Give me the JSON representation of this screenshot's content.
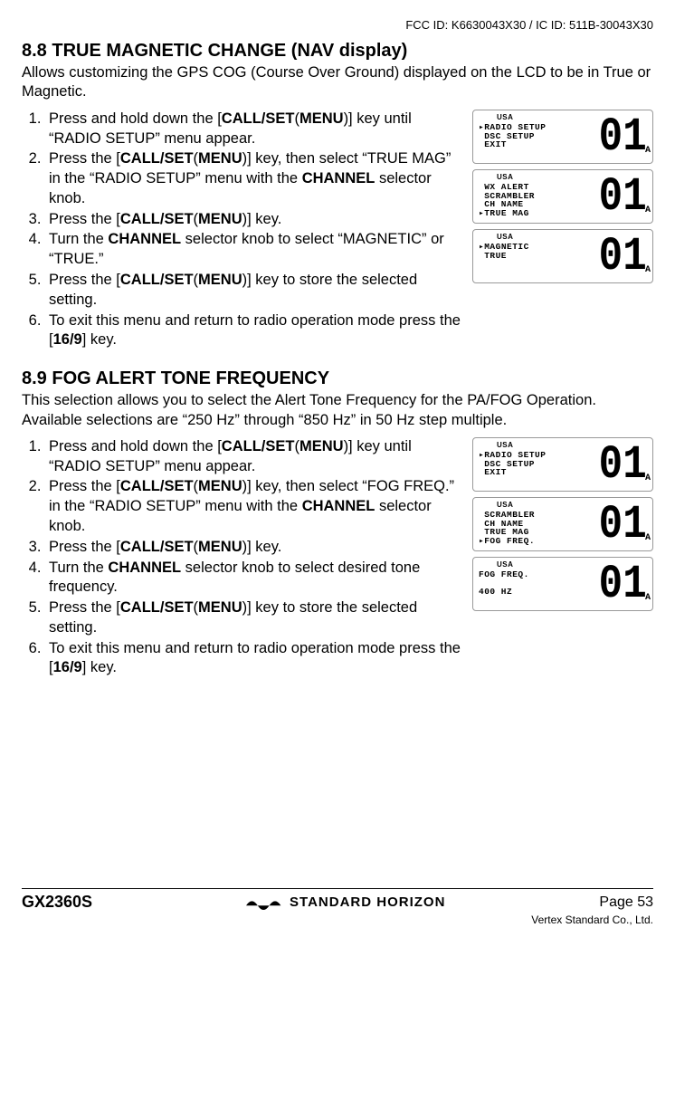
{
  "header": {
    "fcc": "FCC ID: K6630043X30 / IC ID: 511B-30043X30"
  },
  "sec88": {
    "title": "8.8  TRUE MAGNETIC CHANGE (NAV display)",
    "intro": "Allows customizing the GPS COG (Course Over Ground) displayed on the LCD to be in True or Magnetic.",
    "steps": [
      "Press and hold down the [CALL/SET(MENU)] key until “RADIO SETUP” menu appear.",
      "Press the [CALL/SET(MENU)] key, then select “TRUE MAG” in the “RADIO SETUP” menu with the CHANNEL selector knob.",
      "Press the [CALL/SET(MENU)] key.",
      "Turn the CHANNEL selector knob to select “MAGNETIC” or “TRUE.”",
      "Press the [CALL/SET(MENU)] key to store the selected setting.",
      "To exit this menu and return to radio operation mode press the [16/9] key."
    ],
    "lcd": [
      {
        "usa": "USA",
        "lines": "▸RADIO SETUP\n DSC SETUP\n EXIT",
        "ch": "01",
        "a": "A",
        "underline_line": 0
      },
      {
        "usa": "USA",
        "lines": " WX ALERT\n SCRAMBLER\n CH NAME\n▸TRUE MAG",
        "ch": "01",
        "a": "A"
      },
      {
        "usa": "USA",
        "lines": "▸MAGNETIC\n TRUE",
        "ch": "01",
        "a": "A"
      }
    ]
  },
  "sec89": {
    "title": "8.9  FOG ALERT TONE FREQUENCY",
    "intro": "This selection allows you to select the Alert Tone Frequency for the PA/FOG Operation. Available selections are “250 Hz” through “850 Hz” in 50 Hz step multiple.",
    "steps": [
      "Press and hold down the [CALL/SET(MENU)] key until “RADIO SETUP” menu appear.",
      "Press the [CALL/SET(MENU)] key, then select “FOG FREQ.” in the “RADIO SETUP” menu with the CHANNEL selector knob.",
      "Press the [CALL/SET(MENU)] key.",
      "Turn the CHANNEL selector knob to select desired tone frequency.",
      "Press the [CALL/SET(MENU)] key to store the selected setting.",
      "To exit this menu and return to radio operation mode press the [16/9] key."
    ],
    "lcd": [
      {
        "usa": "USA",
        "lines": "▸RADIO SETUP\n DSC SETUP\n EXIT",
        "ch": "01",
        "a": "A",
        "underline_line": 0
      },
      {
        "usa": "USA",
        "lines": " SCRAMBLER\n CH NAME\n TRUE MAG\n▸FOG FREQ.",
        "ch": "01",
        "a": "A"
      },
      {
        "usa": "USA",
        "lines": "FOG FREQ.\n\n400 HZ",
        "ch": "01",
        "a": "A"
      }
    ]
  },
  "footer": {
    "model": "GX2360S",
    "brand": "STANDARD HORIZON",
    "page": "Page 53",
    "company": "Vertex Standard Co., Ltd."
  }
}
